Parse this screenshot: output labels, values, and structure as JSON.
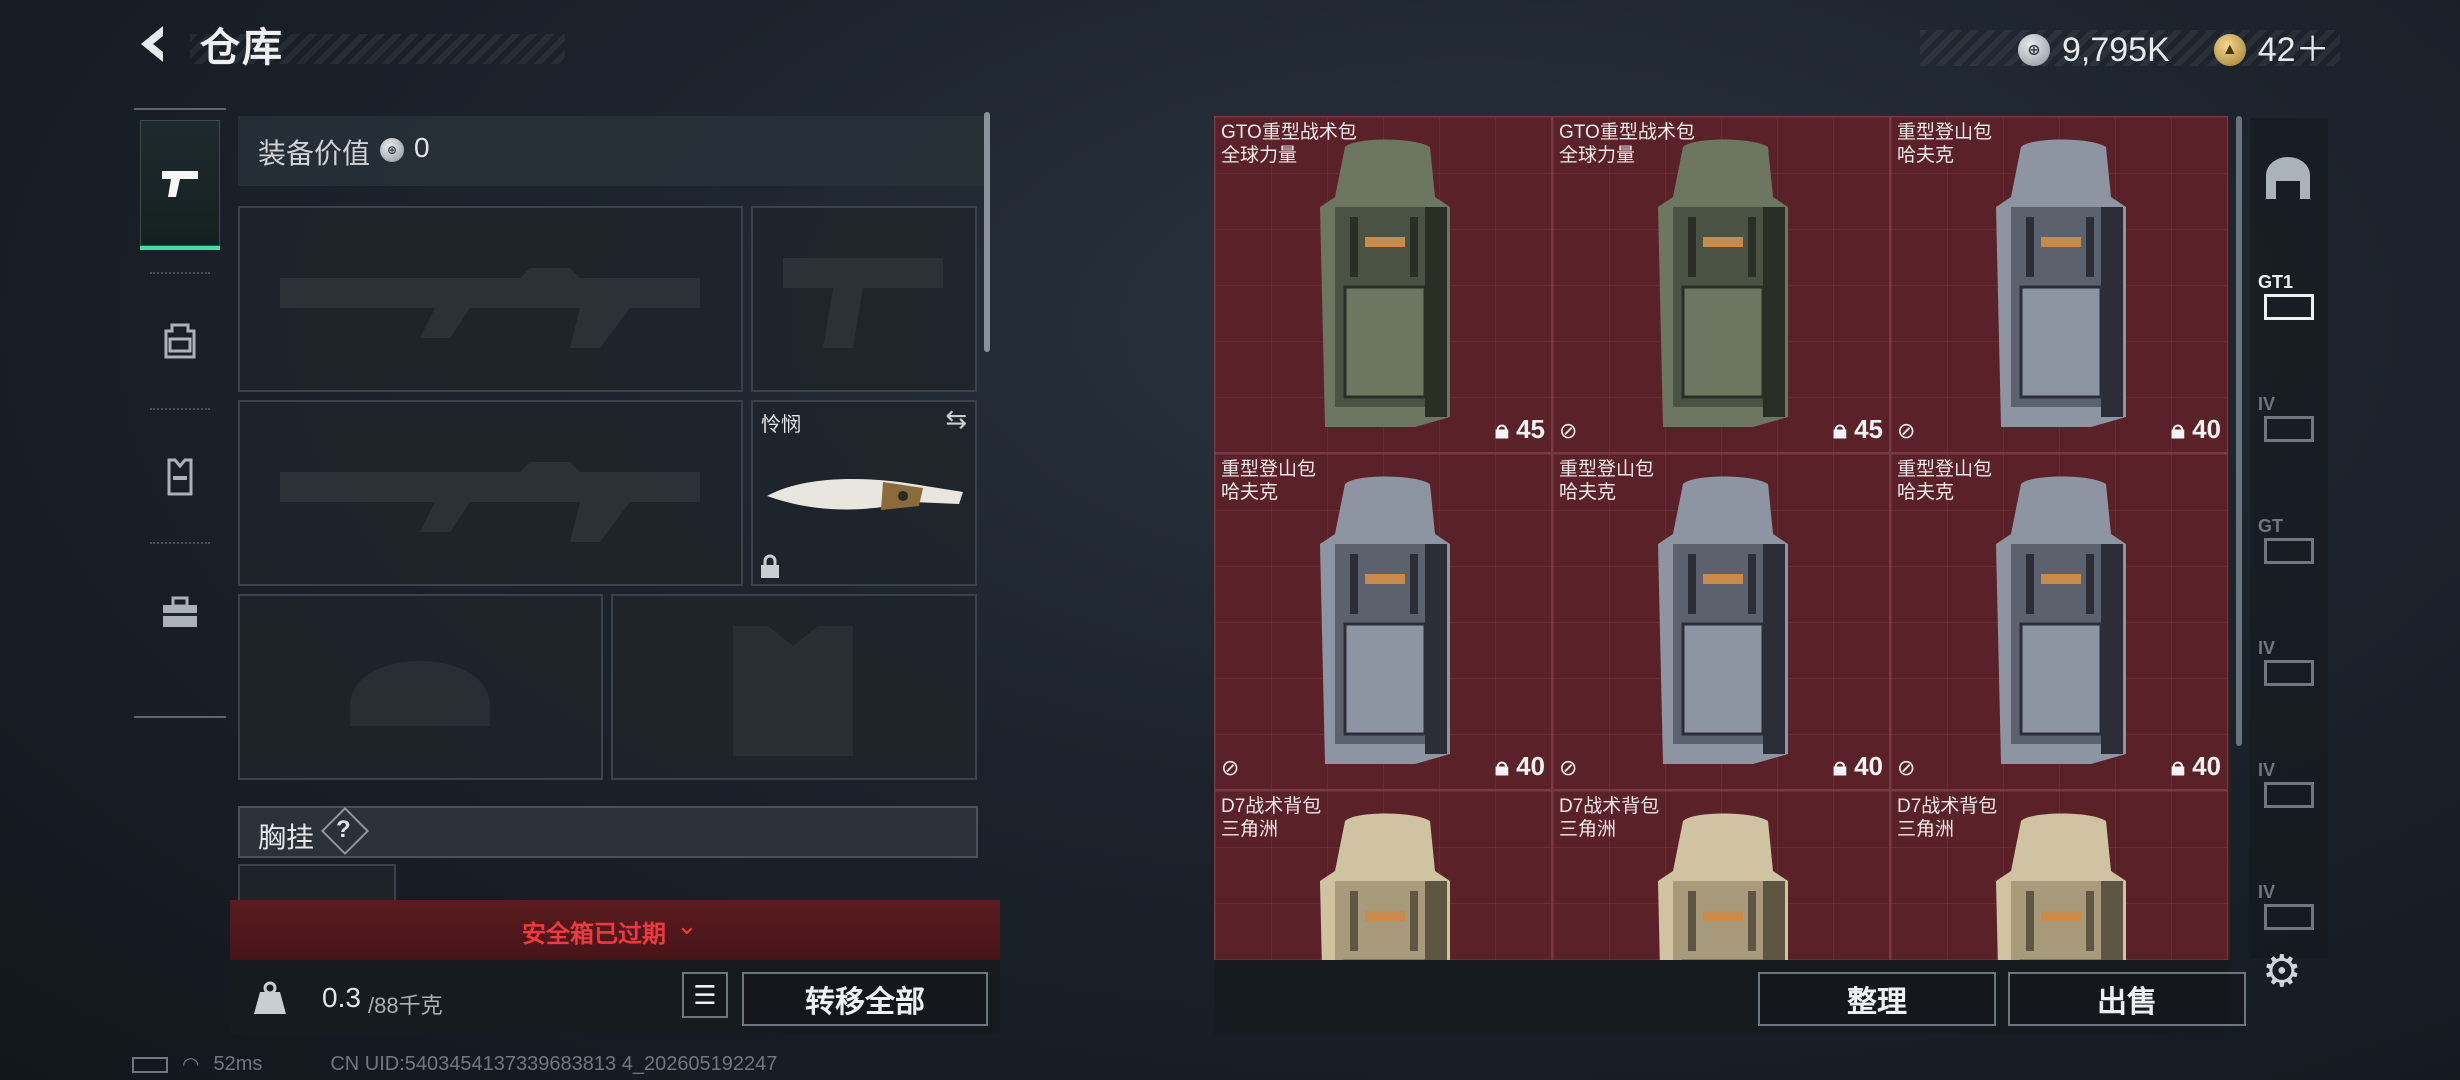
{
  "header": {
    "title": "仓库"
  },
  "currency": {
    "silver": "9,795K",
    "gold": "42＋"
  },
  "left_tabs": [
    {
      "icon": "pistol-icon",
      "active": true
    },
    {
      "icon": "backpack-icon",
      "active": false
    },
    {
      "icon": "vest-icon",
      "active": false
    },
    {
      "icon": "case-icon",
      "active": false
    }
  ],
  "equipment": {
    "value_label": "装备价值",
    "value": "0",
    "melee_name": "怜悯",
    "chest_label": "胸挂",
    "chest_help": "?"
  },
  "safe_box": {
    "text": "安全箱已过期"
  },
  "capacity": {
    "current": "0.3",
    "max": "/88千克"
  },
  "buttons": {
    "transfer_all": "转移全部",
    "sort": "整理",
    "sell": "出售"
  },
  "grid_items": [
    {
      "name1": "GTO重型战术包",
      "name2": "全球力量",
      "weight": "45",
      "style": "olive",
      "nocarry": false
    },
    {
      "name1": "GTO重型战术包",
      "name2": "全球力量",
      "weight": "45",
      "style": "olive",
      "nocarry": true
    },
    {
      "name1": "重型登山包",
      "name2": "哈夫克",
      "weight": "40",
      "style": "grey",
      "nocarry": true
    },
    {
      "name1": "重型登山包",
      "name2": "哈夫克",
      "weight": "40",
      "style": "grey",
      "nocarry": true
    },
    {
      "name1": "重型登山包",
      "name2": "哈夫克",
      "weight": "40",
      "style": "grey",
      "nocarry": true
    },
    {
      "name1": "重型登山包",
      "name2": "哈夫克",
      "weight": "40",
      "style": "grey",
      "nocarry": true
    },
    {
      "name1": "D7战术背包",
      "name2": "三角洲",
      "weight": "",
      "style": "tan",
      "nocarry": false
    },
    {
      "name1": "D7战术背包",
      "name2": "三角洲",
      "weight": "",
      "style": "tan",
      "nocarry": false
    },
    {
      "name1": "D7战术背包",
      "name2": "三角洲",
      "weight": "",
      "style": "tan",
      "nocarry": false
    }
  ],
  "right_strip": [
    "storage-icon",
    "gt1-backpack-icon",
    "iv-backpack-icon",
    "gt-vest-icon",
    "iv-vest-icon",
    "iv-vest-icon-2",
    "iv-vest-icon-3"
  ],
  "right_strip_labels": [
    "",
    "GT1",
    "IV",
    "GT",
    "IV",
    "IV",
    "IV"
  ],
  "status": {
    "ping": "52ms",
    "uid": "CN UID:5403454137339683813 4_202605192247"
  },
  "colors": {
    "accent": "#3ee0a8",
    "danger": "#e0383f",
    "cell_bg": "#5a2228"
  }
}
